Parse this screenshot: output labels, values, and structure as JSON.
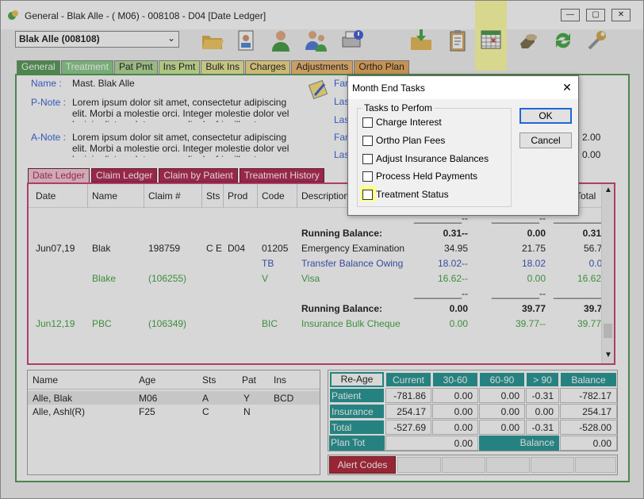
{
  "window": {
    "title": "General - Blak Alle - ( M06) - 008108 - D04 [Date Ledger]",
    "min": "—",
    "max": "▢",
    "close": "✕"
  },
  "patient_select": {
    "value": "Blak Alle (008108)"
  },
  "toolbar": [
    "folder-open-icon",
    "patient-card-icon",
    "user-icon",
    "family-icon",
    "print-alert-icon",
    "folder-download-icon",
    "clipboard-icon",
    "calendar-icon",
    "hand-money-icon",
    "refresh-icon",
    "wrench-icon"
  ],
  "main_tabs": [
    {
      "label": "General",
      "color": "#3f8f3f",
      "text": "#fff"
    },
    {
      "label": "Treatment",
      "color": "#7bc67b",
      "text": "#fff"
    },
    {
      "label": "Pat Pmt",
      "color": "#a8d68a",
      "text": "#000"
    },
    {
      "label": "Ins Pmt",
      "color": "#c8e68a",
      "text": "#000"
    },
    {
      "label": "Bulk Ins",
      "color": "#e6e68a",
      "text": "#000"
    },
    {
      "label": "Charges",
      "color": "#f0d678",
      "text": "#000"
    },
    {
      "label": "Adjustments",
      "color": "#f0b060",
      "text": "#000"
    },
    {
      "label": "Ortho Plan",
      "color": "#e8a048",
      "text": "#000"
    }
  ],
  "info": {
    "name_label": "Name :",
    "name_value": "Mast. Blak Alle",
    "pnote_label": "P-Note :",
    "pnote_text": "Lorem ipsum dolor sit amet, consectetur adipiscing elit. Morbi a molestie orci. Integer molestie dolor vel lacinia dictum. Integer sem ligula, fringilla et magna eget, mattis dapibus eros.",
    "anote_label": "A-Note :",
    "anote_text": "Lorem ipsum dolor sit amet, consectetur adipiscing elit. Morbi a molestie orci. Integer molestie dolor vel lacinia dictum. Integer sem ligula, fringilla et magna eget, mattis dapibus eros.",
    "right_labels": [
      "Fan",
      "Las",
      "Las",
      "Fan",
      "Las"
    ],
    "right_values": [
      "",
      "",
      "",
      "2.00",
      "0.00"
    ]
  },
  "ledger_tabs": [
    "Date Ledger",
    "Claim Ledger",
    "Claim by Patient",
    "Treatment History"
  ],
  "ledger_headers": [
    "Date",
    "Name",
    "Claim #",
    "Sts",
    "Prod",
    "Code",
    "Description",
    "",
    "",
    "Total"
  ],
  "ledger_rows": [
    {
      "date": "",
      "name": "",
      "claim": "",
      "sts": "",
      "prod": "",
      "code": "",
      "desc": "",
      "a": "_________--",
      "b": "_________--",
      "c": "_________--",
      "color": "#000",
      "bold": false
    },
    {
      "date": "",
      "name": "",
      "claim": "",
      "sts": "",
      "prod": "",
      "code": "",
      "desc": "Running Balance:",
      "a": "0.31--",
      "b": "0.00",
      "c": "0.31--",
      "color": "#000",
      "bold": true
    },
    {
      "date": "Jun07,19",
      "name": "Blak",
      "claim": "198759",
      "sts": "C E",
      "prod": "D04",
      "code": "01205",
      "desc": "Emergency Examination",
      "a": "34.95",
      "b": "21.75",
      "c": "56.70",
      "color": "#000",
      "bold": false
    },
    {
      "date": "",
      "name": "",
      "claim": "",
      "sts": "",
      "prod": "",
      "code": "TB",
      "desc": "Transfer Balance Owing",
      "a": "18.02--",
      "b": "18.02",
      "c": "0.00",
      "color": "#1f3fb0",
      "bold": false
    },
    {
      "date": "",
      "name": "Blake",
      "claim": "(106255)",
      "sts": "",
      "prod": "",
      "code": "V",
      "desc": "Visa",
      "a": "16.62--",
      "b": "0.00",
      "c": "16.62--",
      "color": "#2a9a2a",
      "bold": false
    },
    {
      "date": "",
      "name": "",
      "claim": "",
      "sts": "",
      "prod": "",
      "code": "",
      "desc": "",
      "a": "_________--",
      "b": "_________--",
      "c": "_________--",
      "color": "#000",
      "bold": false
    },
    {
      "date": "",
      "name": "",
      "claim": "",
      "sts": "",
      "prod": "",
      "code": "",
      "desc": "Running Balance:",
      "a": "0.00",
      "b": "39.77",
      "c": "39.77",
      "color": "#000",
      "bold": true
    },
    {
      "date": "Jun12,19",
      "name": "PBC",
      "claim": "(106349)",
      "sts": "",
      "prod": "",
      "code": "BIC",
      "desc": "Insurance Bulk Cheque",
      "a": "0.00",
      "b": "39.77--",
      "c": "39.77--",
      "color": "#2a9a2a",
      "bold": false
    }
  ],
  "family_headers": [
    "Name",
    "Age",
    "Sts",
    "Pat",
    "Ins"
  ],
  "family_rows": [
    {
      "name": "Alle, Blak",
      "age": "M06",
      "sts": "A",
      "pat": "Y",
      "ins": "BCD"
    },
    {
      "name": "Alle, Ashl(R)",
      "age": "F25",
      "sts": "C",
      "pat": "N",
      "ins": ""
    }
  ],
  "aging": {
    "reage": "Re-Age",
    "headers": [
      "Current",
      "30-60",
      "60-90",
      "> 90",
      "Balance"
    ],
    "rows": [
      {
        "label": "Patient",
        "vals": [
          "-781.86",
          "0.00",
          "0.00",
          "-0.31",
          "-782.17"
        ]
      },
      {
        "label": "Insurance",
        "vals": [
          "254.17",
          "0.00",
          "0.00",
          "0.00",
          "254.17"
        ]
      },
      {
        "label": "Total",
        "vals": [
          "-527.69",
          "0.00",
          "0.00",
          "-0.31",
          "-528.00"
        ]
      }
    ],
    "plan_tot_label": "Plan Tot",
    "plan_tot_value": "0.00",
    "balance_label": "Balance",
    "balance_value": "0.00"
  },
  "alert": {
    "label": "Alert Codes"
  },
  "dialog": {
    "title": "Month End Tasks",
    "close": "✕",
    "group": "Tasks to Perfom",
    "tasks": [
      "Charge Interest",
      "Ortho Plan Fees",
      "Adjust Insurance Balances",
      "Process Held Payments",
      "Treatment Status"
    ],
    "ok": "OK",
    "cancel": "Cancel"
  },
  "colors": {
    "highlight": "#ffff8a",
    "teal": "#0a8a87",
    "ledger_border": "#c72a6a",
    "main_border": "#3f8f3f"
  }
}
